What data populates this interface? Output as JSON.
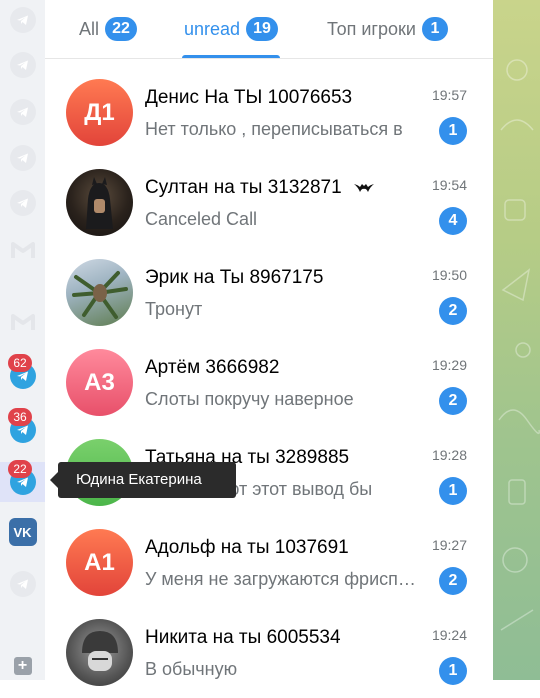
{
  "rail": {
    "badges": [
      "62",
      "36",
      "22"
    ],
    "vk_label": "VK",
    "add_label": "+"
  },
  "tooltip": "Юдина Екатерина",
  "tabs": [
    {
      "label": "All",
      "count": "22"
    },
    {
      "label": "unread",
      "count": "19"
    },
    {
      "label": "Топ игроки",
      "count": "1"
    }
  ],
  "chats": [
    {
      "initials": "Д1",
      "name": "Денис На ТЫ 10076653",
      "preview": "Нет только , переписываться в",
      "time": "19:57",
      "unread": "1",
      "color": "#e8543a"
    },
    {
      "initials": "",
      "name": "Султан на ты 3132871",
      "preview": "Canceled Call",
      "time": "19:54",
      "unread": "4",
      "color": "#3a2f28"
    },
    {
      "initials": "",
      "name": "Эрик на Ты 8967175",
      "preview": "Тронут",
      "time": "19:50",
      "unread": "2",
      "color": "#6a8c5a"
    },
    {
      "initials": "А3",
      "name": "Артём 3666982",
      "preview": "Слоты покручу наверное",
      "time": "19:29",
      "unread": "2",
      "color": "#ef5b72"
    },
    {
      "initials": "",
      "name": "Татьяна на ты 3289885",
      "preview": "7960607 вот этот вывод бы",
      "time": "19:28",
      "unread": "1",
      "color": "#5fc259"
    },
    {
      "initials": "А1",
      "name": "Адольф на ты 1037691",
      "preview": "У меня не загружаются фриспины",
      "time": "19:27",
      "unread": "2",
      "color": "#e8543a"
    },
    {
      "initials": "",
      "name": "Никита на ты 6005534",
      "preview": "В обычную",
      "time": "19:24",
      "unread": "1",
      "color": "#6c6c6c"
    }
  ]
}
